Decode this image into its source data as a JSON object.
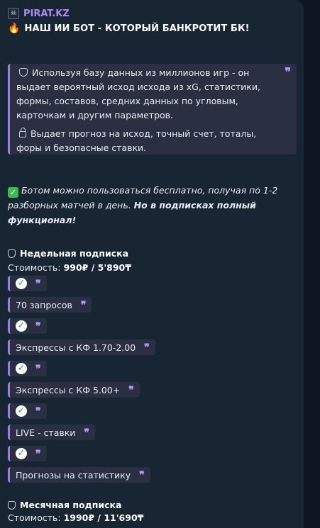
{
  "post": {
    "channel": "PIRAT.KZ",
    "title": "НАШ ИИ БОТ - КОТОРЫЙ БАНКРОТИТ БК!",
    "quote_p1": "Используя базу данных из миллионов игр - он выдает вероятный исход исхода из  xG, статистики, формы, составов, средних данных по угловым, карточкам и другим параметров.",
    "quote_p2": "Выдает прогноз на исход, точный счет, тоталы, форы и безопасные ставки.",
    "free_text": "Ботом можно пользоваться бесплатно, получая по 1-2 разборных матчей в день.",
    "free_bold": "Но в подписках полный функционал!",
    "weekly": {
      "title": "Недельная подписка",
      "price_label": "Стоимость:",
      "price_value": "990₽ / 5'890₸",
      "features": [
        "70 запросов",
        "Экспрессы с КФ 1.70-2.00",
        "Экспрессы с КФ 5.00+",
        "LIVE - ставки",
        "Прогнозы на статистику"
      ]
    },
    "monthly": {
      "title": "Месячная подписка",
      "price_label": "Стоимость:",
      "price_value": "1990₽ / 11'690₸"
    },
    "quote_mark": "❞",
    "check_mark": "✓"
  },
  "icons": [
    "pirate-flag-icon",
    "fire-icon",
    "shield-icon",
    "lock-icon",
    "check-box-icon",
    "check-circle-icon",
    "quote-icon"
  ],
  "colors": {
    "background": "#0e1621",
    "bubble": "#182533",
    "accent": "#9b7de6",
    "channel": "#a98cf0",
    "check": "#3fb950"
  }
}
